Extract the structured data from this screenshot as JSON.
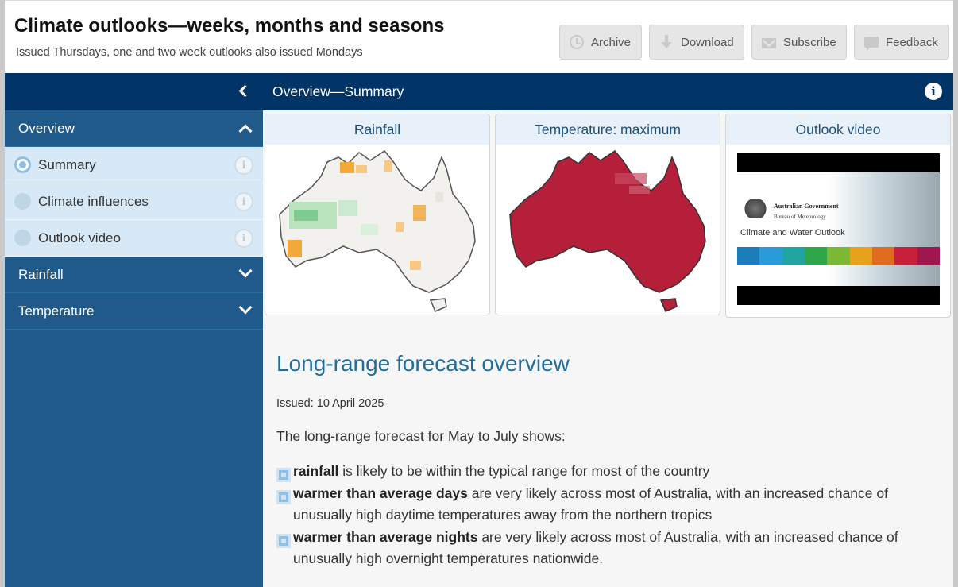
{
  "header": {
    "title": "Climate outlooks—weeks, months and seasons",
    "subtitle": "Issued Thursdays, one and two week outlooks also issued Mondays",
    "buttons": [
      {
        "label": "Archive",
        "icon": "clock-icon"
      },
      {
        "label": "Download",
        "icon": "download-icon"
      },
      {
        "label": "Subscribe",
        "icon": "envelope-icon"
      },
      {
        "label": "Feedback",
        "icon": "speech-bubble-icon"
      }
    ]
  },
  "sidebar": {
    "sections": [
      {
        "label": "Overview",
        "expanded": true,
        "items": [
          {
            "label": "Summary",
            "selected": true
          },
          {
            "label": "Climate influences",
            "selected": false
          },
          {
            "label": "Outlook video",
            "selected": false
          }
        ]
      },
      {
        "label": "Rainfall",
        "expanded": false
      },
      {
        "label": "Temperature",
        "expanded": false
      }
    ]
  },
  "main": {
    "heading": "Overview—Summary",
    "cards": [
      {
        "title": "Rainfall"
      },
      {
        "title": "Temperature: maximum"
      },
      {
        "title": "Outlook video",
        "video": {
          "gov": "Australian Government",
          "bureau": "Bureau of Meteorology",
          "name": "Climate and Water Outlook"
        }
      }
    ],
    "article": {
      "title": "Long-range forecast overview",
      "issued": "Issued: 10 April 2025",
      "lead": "The long-range forecast for May to July shows:",
      "bullets": [
        {
          "bold": "rainfall",
          "text": " is likely to be within the typical range for most of the country"
        },
        {
          "bold": "warmer than average days",
          "text": " are very likely across most of Australia, with an increased chance of unusually high daytime temperatures away from the northern tropics"
        },
        {
          "bold": "warmer than average nights",
          "text": " are very likely across most of Australia, with an increased chance of unusually high overnight temperatures nationwide."
        }
      ]
    }
  },
  "colors": {
    "navy": "#013466",
    "sidebar": "#1f5a8a",
    "accent_text": "#1f6c9e",
    "temp_red": "#b51f3a",
    "rain_green": "#9fd8a7",
    "rain_orange": "#f2a93b"
  }
}
